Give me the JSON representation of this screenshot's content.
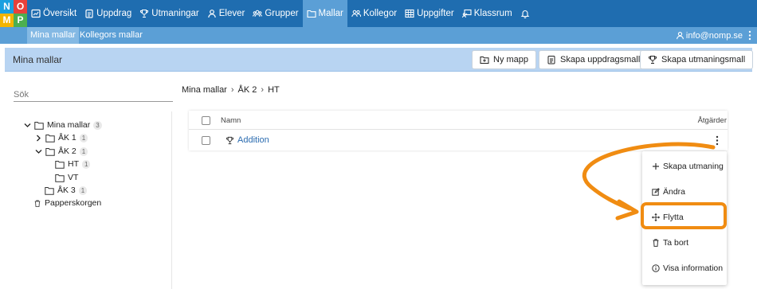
{
  "nav": {
    "logo_letters": [
      "N",
      "O",
      "M",
      "P"
    ],
    "items": [
      {
        "label": "Översikt",
        "icon": "dashboard-icon"
      },
      {
        "label": "Uppdrag",
        "icon": "clipboard-icon"
      },
      {
        "label": "Utmaningar",
        "icon": "trophy-icon"
      },
      {
        "label": "Elever",
        "icon": "person-icon"
      },
      {
        "label": "Grupper",
        "icon": "group-icon"
      },
      {
        "label": "Mallar",
        "icon": "folder-icon"
      },
      {
        "label": "Kollegor",
        "icon": "colleagues-icon"
      },
      {
        "label": "Uppgifter",
        "icon": "grid-icon"
      },
      {
        "label": "Klassrum",
        "icon": "classroom-icon"
      }
    ],
    "active": "Mallar"
  },
  "subnav": {
    "items": [
      "Mina mallar",
      "Kollegors mallar"
    ],
    "user_email": "info@nomp.se"
  },
  "header": {
    "title": "Mina mallar",
    "buttons": [
      "Ny mapp",
      "Skapa uppdragsmall",
      "Skapa utmaningsmall"
    ]
  },
  "search": {
    "placeholder": "Sök"
  },
  "tree": {
    "root": {
      "label": "Mina mallar",
      "count": "3"
    },
    "children": [
      {
        "label": "ÅK 1",
        "count": "1"
      },
      {
        "label": "ÅK 2",
        "count": "1"
      },
      {
        "label": "HT",
        "count": "1"
      },
      {
        "label": "VT",
        "count": ""
      },
      {
        "label": "ÅK 3",
        "count": "1"
      }
    ],
    "trash": "Papperskorgen"
  },
  "breadcrumb": [
    "Mina mallar",
    "ÅK 2",
    "HT"
  ],
  "table": {
    "columns": {
      "name": "Namn",
      "actions": "Åtgärder"
    },
    "rows": [
      {
        "name": "Addition"
      }
    ]
  },
  "menu": {
    "items": [
      "Skapa utmaning",
      "Ändra",
      "Flytta",
      "Ta bort",
      "Visa information"
    ]
  },
  "colors": {
    "nav_bg": "#1f6db0",
    "subnav_bg": "#5b9fd6",
    "header_bg": "#b8d4f2",
    "highlight": "#f08c12",
    "link": "#2b6cb0"
  }
}
